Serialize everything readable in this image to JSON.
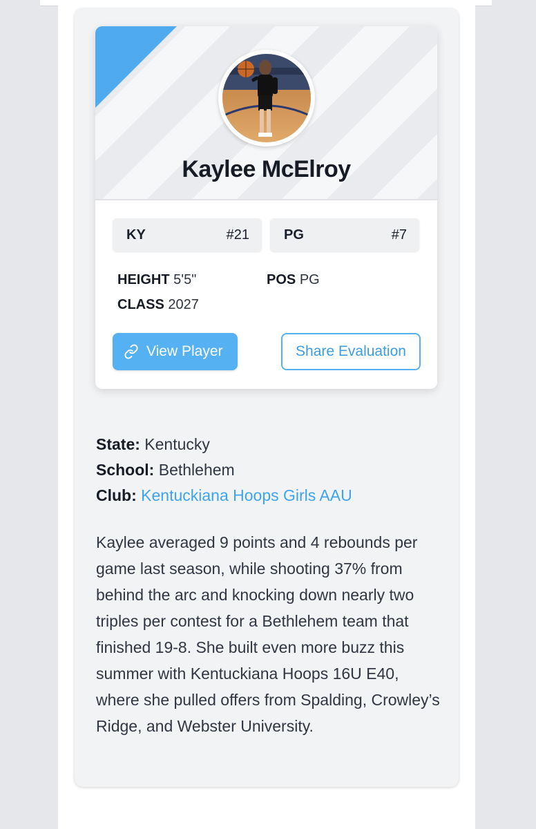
{
  "player": {
    "name": "Kaylee McElroy",
    "photo_alt": "player-photo"
  },
  "badges": [
    {
      "label": "KY",
      "value": "#21"
    },
    {
      "label": "PG",
      "value": "#7"
    }
  ],
  "stats": {
    "height_label": "HEIGHT",
    "height_value": "5'5\"",
    "pos_label": "POS",
    "pos_value": "PG",
    "class_label": "CLASS",
    "class_value": "2027"
  },
  "buttons": {
    "view_player": "View Player",
    "share_evaluation": "Share Evaluation"
  },
  "info": {
    "state_label": "State:",
    "state_value": "Kentucky",
    "school_label": "School:",
    "school_value": "Bethlehem",
    "club_label": "Club:",
    "club_value": "Kentuckiana Hoops Girls AAU"
  },
  "bio": "Kaylee averaged 9 points and 4 rebounds per game last season, while shooting 37% from behind the arc and knocking down nearly two triples per contest for a Bethlehem team that finished 19-8. She built even more buzz this summer with Kentuckiana Hoops 16U E40, where she pulled offers from Spalding, Crowley’s Ridge, and Webster University.",
  "colors": {
    "accent": "#56b1f2",
    "link": "#3ea4ec",
    "text": "#161b26"
  },
  "icons": {
    "view_player": "link-icon"
  }
}
